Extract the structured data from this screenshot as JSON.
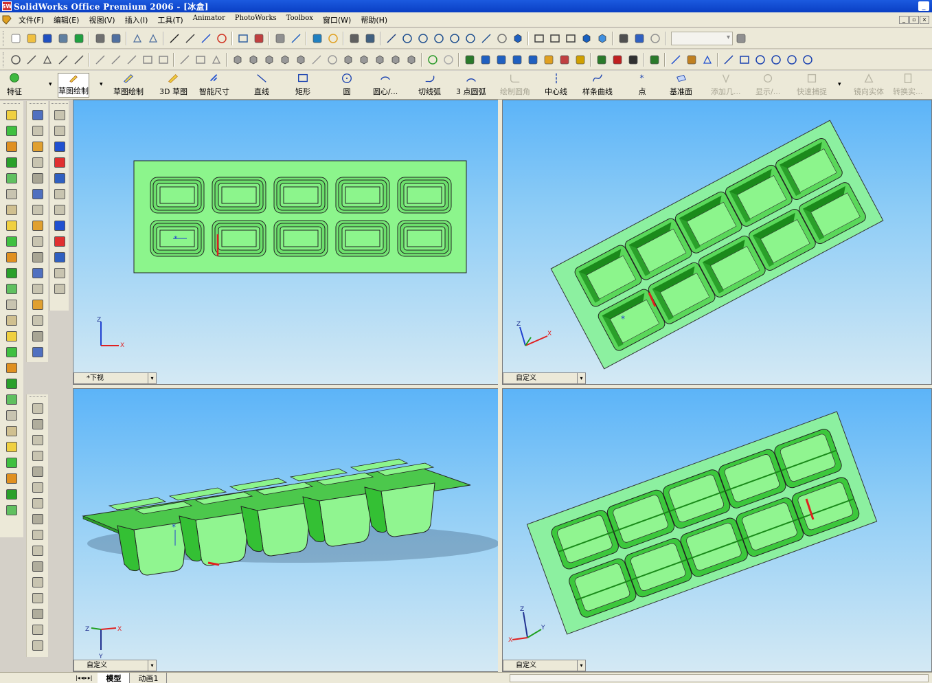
{
  "window": {
    "title": "SolidWorks Office Premium 2006 - [冰盒]",
    "logo_text": "SW"
  },
  "menubar": {
    "items": [
      {
        "label": "文件(F)"
      },
      {
        "label": "编辑(E)"
      },
      {
        "label": "视图(V)"
      },
      {
        "label": "插入(I)"
      },
      {
        "label": "工具(T)"
      },
      {
        "label": "Animator"
      },
      {
        "label": "PhotoWorks"
      },
      {
        "label": "Toolbox"
      },
      {
        "label": "窗口(W)"
      },
      {
        "label": "帮助(H)"
      }
    ]
  },
  "command_manager": {
    "buttons": [
      {
        "label": "特征",
        "icon": "features-icon",
        "color": "#2e9a2e",
        "enabled": true
      },
      {
        "label": "草图绘制",
        "icon": "sketch-icon",
        "color": "#c03030",
        "enabled": true,
        "toggled": true
      },
      {
        "label": "草图绘制",
        "icon": "sketch-edit-icon",
        "color": "#2050d0",
        "enabled": true
      },
      {
        "label": "3D 草图",
        "icon": "3d-sketch-icon",
        "color": "#c08020",
        "enabled": true
      },
      {
        "label": "智能尺寸",
        "icon": "smart-dimension-icon",
        "color": "#2050d0",
        "enabled": true
      },
      {
        "label": "直线",
        "icon": "line-icon",
        "color": "#1840b0",
        "enabled": true
      },
      {
        "label": "矩形",
        "icon": "rectangle-icon",
        "color": "#1840b0",
        "enabled": true
      },
      {
        "label": "圆",
        "icon": "circle-icon",
        "color": "#1840b0",
        "enabled": true
      },
      {
        "label": "圆心/...",
        "icon": "center-arc-icon",
        "color": "#1840b0",
        "enabled": true
      },
      {
        "label": "切线弧",
        "icon": "tangent-arc-icon",
        "color": "#1840b0",
        "enabled": true
      },
      {
        "label": "3 点圆弧",
        "icon": "3-point-arc-icon",
        "color": "#1840b0",
        "enabled": true
      },
      {
        "label": "绘制圆角",
        "icon": "sketch-fillet-icon",
        "color": "#a8a594",
        "enabled": false
      },
      {
        "label": "中心线",
        "icon": "centerline-icon",
        "color": "#1840b0",
        "enabled": true
      },
      {
        "label": "样条曲线",
        "icon": "spline-icon",
        "color": "#1840b0",
        "enabled": true
      },
      {
        "label": "点",
        "icon": "point-icon",
        "color": "#1840b0",
        "enabled": true
      },
      {
        "label": "基准面",
        "icon": "plane-icon",
        "color": "#1840b0",
        "enabled": true
      },
      {
        "label": "添加几...",
        "icon": "add-relation-icon",
        "color": "#a8a594",
        "enabled": false
      },
      {
        "label": "显示/...",
        "icon": "display-relations-icon",
        "color": "#a8a594",
        "enabled": false
      },
      {
        "label": "快速捕捉",
        "icon": "quick-snap-icon",
        "color": "#a8a594",
        "enabled": false
      },
      {
        "label": "镜向实体",
        "icon": "mirror-entities-icon",
        "color": "#a8a594",
        "enabled": false
      },
      {
        "label": "转换实...",
        "icon": "convert-entities-icon",
        "color": "#a8a594",
        "enabled": false
      }
    ]
  },
  "viewports": [
    {
      "label": "*下视",
      "view": "bottom"
    },
    {
      "label": "自定义",
      "view": "iso-top"
    },
    {
      "label": "自定义",
      "view": "iso-side"
    },
    {
      "label": "自定义",
      "view": "iso-under"
    }
  ],
  "triads": {
    "x": "X",
    "y": "Y",
    "z": "Z"
  },
  "bottom_tabs": [
    {
      "label": "模型",
      "active": true
    },
    {
      "label": "动画1",
      "active": false
    }
  ],
  "colors": {
    "title_bar": "#0a3fc4",
    "part_light": "#8cf58c",
    "part_mid": "#3ccf3c",
    "part_dark": "#1a9a1a",
    "selected_edge": "#e02020",
    "sketch_blue": "#2040d0"
  }
}
